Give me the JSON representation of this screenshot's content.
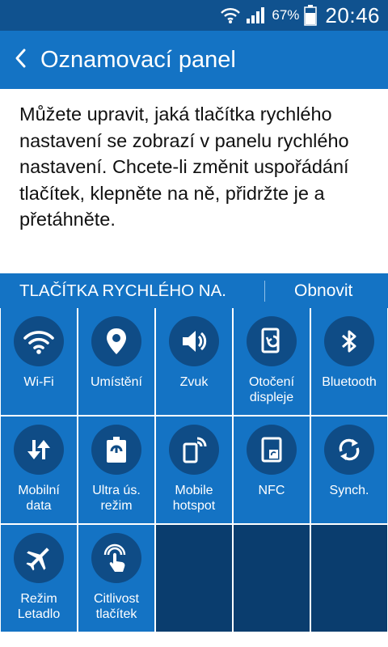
{
  "status_bar": {
    "battery_percent": "67%",
    "time": "20:46",
    "icons": [
      "wifi-signal-icon",
      "cell-signal-icon",
      "battery-icon"
    ]
  },
  "header": {
    "back_icon": "chevron-left-icon",
    "title": "Oznamovací panel"
  },
  "description": "Můžete upravit, jaká tlačítka rychlého nastavení se zobrazí v panelu rychlého nastavení. Chcete-li změnit uspořádání tlačítek, klepněte na ně, přidržte je a přetáhněte.",
  "section": {
    "title": "TLAČÍTKA RYCHLÉHO NA.",
    "reset_label": "Obnovit"
  },
  "tiles": [
    {
      "label": "Wi-Fi",
      "icon": "wifi-icon"
    },
    {
      "label": "Umístění",
      "icon": "location-pin-icon"
    },
    {
      "label": "Zvuk",
      "icon": "speaker-icon"
    },
    {
      "label": "Otočení\ndispleje",
      "icon": "screen-rotation-icon"
    },
    {
      "label": "Bluetooth",
      "icon": "bluetooth-icon"
    },
    {
      "label": "Mobilní\ndata",
      "icon": "mobile-data-icon"
    },
    {
      "label": "Ultra ús.\nrežim",
      "icon": "power-saving-icon"
    },
    {
      "label": "Mobile\nhotspot",
      "icon": "hotspot-icon"
    },
    {
      "label": "NFC",
      "icon": "nfc-icon"
    },
    {
      "label": "Synch.",
      "icon": "sync-icon"
    },
    {
      "label": "Režim\nLetadlo",
      "icon": "airplane-icon"
    },
    {
      "label": "Citlivost\ntlačítek",
      "icon": "touch-sensitivity-icon"
    }
  ],
  "colors": {
    "status_bar": "#10528f",
    "primary": "#1473c4",
    "icon_circle": "#0f4c86",
    "empty_tile": "#0a3d6e"
  }
}
